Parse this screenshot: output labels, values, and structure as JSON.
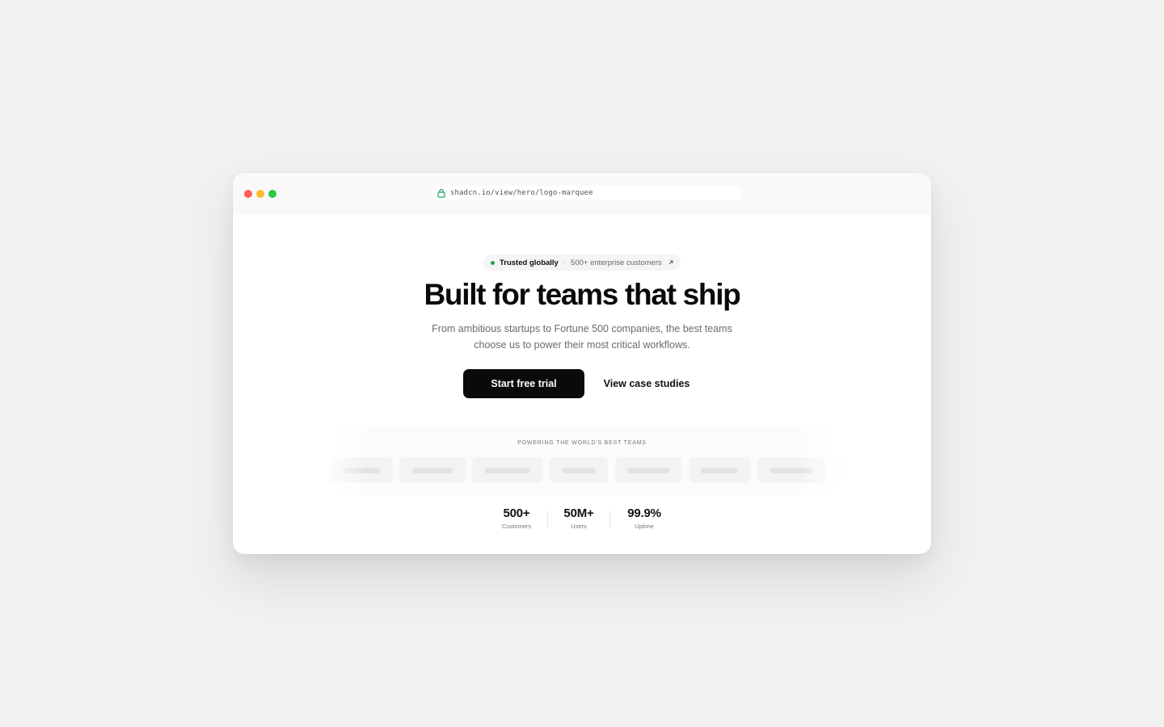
{
  "browser": {
    "url": "shadcn.io/view/hero/logo-marquee"
  },
  "badge": {
    "strong": "Trusted globally",
    "separator": "·",
    "light": "500+ enterprise customers"
  },
  "hero": {
    "headline": "Built for teams that ship",
    "subtitle": "From ambitious startups to Fortune 500 companies, the best teams choose us to power their most critical workflows."
  },
  "actions": {
    "primary": "Start free trial",
    "secondary": "View case studies"
  },
  "logos": {
    "label": "POWERING THE WORLD'S BEST TEAMS"
  },
  "stats": [
    {
      "value": "500+",
      "label": "Customers"
    },
    {
      "value": "50M+",
      "label": "Users"
    },
    {
      "value": "99.9%",
      "label": "Uptime"
    }
  ],
  "colors": {
    "background": "#f1f1f1",
    "primary_button": "#0a0a0a",
    "status_dot": "#22a35a",
    "traffic_red": "#ff5f57",
    "traffic_yellow": "#febc2e",
    "traffic_green": "#28c840"
  }
}
